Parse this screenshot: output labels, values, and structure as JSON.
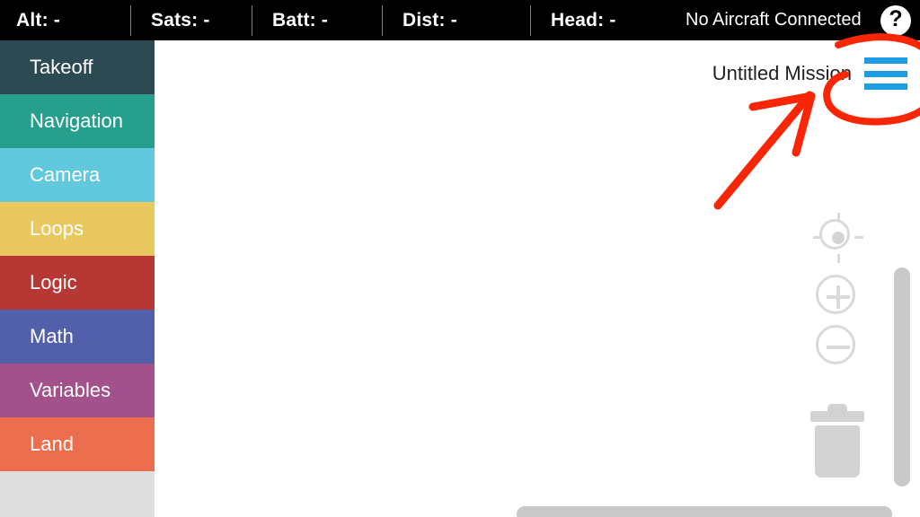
{
  "topbar": {
    "stats": [
      {
        "name": "altitude",
        "label": "Alt: -"
      },
      {
        "name": "satellites",
        "label": "Sats: -"
      },
      {
        "name": "battery",
        "label": "Batt: -"
      },
      {
        "name": "distance",
        "label": "Dist: -"
      },
      {
        "name": "heading",
        "label": "Head: -"
      }
    ],
    "connection_status": "No Aircraft Connected",
    "help_glyph": "?"
  },
  "sidebar": {
    "categories": [
      {
        "label": "Takeoff",
        "color": "#2c4a52"
      },
      {
        "label": "Navigation",
        "color": "#26a08c"
      },
      {
        "label": "Camera",
        "color": "#62c8de"
      },
      {
        "label": "Loops",
        "color": "#e9c95f"
      },
      {
        "label": "Logic",
        "color": "#b63734"
      },
      {
        "label": "Math",
        "color": "#5260ab"
      },
      {
        "label": "Variables",
        "color": "#a3518a"
      },
      {
        "label": "Land",
        "color": "#ec6e4e"
      }
    ],
    "empty_area_color": "#dedede"
  },
  "canvas": {
    "mission_title": "Untitled Mission",
    "menu_icon": "hamburger-icon",
    "menu_color": "#1e9de5",
    "controls": [
      {
        "name": "locate-button",
        "icon": "crosshair-icon"
      },
      {
        "name": "zoom-in-button",
        "icon": "plus-icon"
      },
      {
        "name": "zoom-out-button",
        "icon": "minus-icon"
      }
    ],
    "trash": {
      "name": "trash-button",
      "icon": "trash-icon"
    },
    "scrollbars": {
      "vertical": "vertical-scrollbar",
      "horizontal": "horizontal-scrollbar"
    }
  },
  "annotation": {
    "color": "#f92605",
    "shapes": [
      "ellipse-highlight",
      "arrow-pointer"
    ],
    "target": "hamburger-icon"
  },
  "colors": {
    "topbar_bg": "#000000",
    "canvas_bg": "#ffffff",
    "accent_blue": "#1e9de5",
    "annotation_red": "#f92605",
    "control_gray": "#d9d9d9",
    "scrollbar_gray": "#c9c9c9"
  }
}
